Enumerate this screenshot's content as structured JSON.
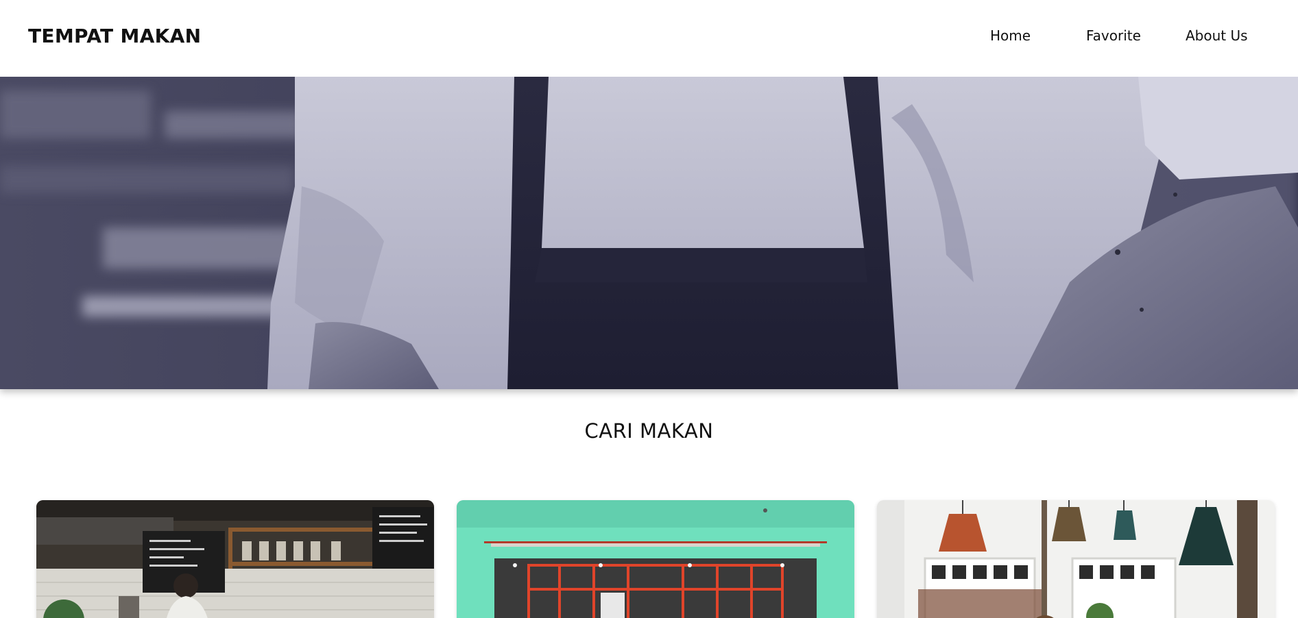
{
  "header": {
    "brand": "TEMPAT MAKAN",
    "nav": [
      {
        "label": "Home"
      },
      {
        "label": "Favorite"
      },
      {
        "label": "About Us"
      }
    ]
  },
  "hero": {
    "image": "chef-in-apron-photo",
    "overlay_color": "#2b2b4a"
  },
  "main": {
    "section_title": "CARI MAKAN",
    "restaurants": [
      {
        "image": "cafe-counter-with-chalkboard-menu-photo"
      },
      {
        "image": "mint-green-storefront-with-red-window-frames-photo"
      },
      {
        "image": "bright-cafe-interior-with-pendant-lamps-photo"
      }
    ]
  },
  "colors": {
    "background": "#ffffff",
    "text": "#111111",
    "hero_tint": "#2b2b4a",
    "storefront_green": "#6fe0bd",
    "window_frame_red": "#e0442a"
  }
}
